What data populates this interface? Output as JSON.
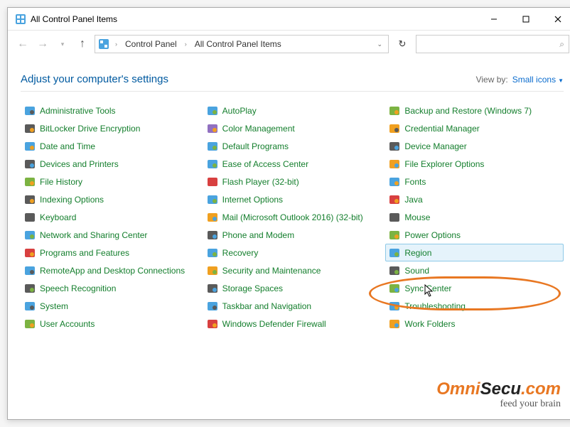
{
  "window": {
    "title": "All Control Panel Items"
  },
  "breadcrumb": {
    "root": "Control Panel",
    "leaf": "All Control Panel Items"
  },
  "search": {
    "placeholder": ""
  },
  "heading": "Adjust your computer's settings",
  "view": {
    "label": "View by:",
    "value": "Small icons"
  },
  "cols": [
    [
      "Administrative Tools",
      "BitLocker Drive Encryption",
      "Date and Time",
      "Devices and Printers",
      "File History",
      "Indexing Options",
      "Keyboard",
      "Network and Sharing Center",
      "Programs and Features",
      "RemoteApp and Desktop Connections",
      "Speech Recognition",
      "System",
      "User Accounts"
    ],
    [
      "AutoPlay",
      "Color Management",
      "Default Programs",
      "Ease of Access Center",
      "Flash Player (32-bit)",
      "Internet Options",
      "Mail (Microsoft Outlook 2016) (32-bit)",
      "Phone and Modem",
      "Recovery",
      "Security and Maintenance",
      "Storage Spaces",
      "Taskbar and Navigation",
      "Windows Defender Firewall"
    ],
    [
      "Backup and Restore (Windows 7)",
      "Credential Manager",
      "Device Manager",
      "File Explorer Options",
      "Fonts",
      "Java",
      "Mouse",
      "Power Options",
      "Region",
      "Sound",
      "Sync Center",
      "Troubleshooting",
      "Work Folders"
    ]
  ],
  "icons": {
    "c0": [
      "admin-tools",
      "bitlocker",
      "date-time",
      "devices-printers",
      "file-history",
      "indexing",
      "keyboard",
      "network-sharing",
      "programs-features",
      "remoteapp",
      "speech",
      "system",
      "user-accounts"
    ],
    "c1": [
      "autoplay",
      "color-mgmt",
      "default-programs",
      "ease-access",
      "flash",
      "internet",
      "mail",
      "phone-modem",
      "recovery",
      "security",
      "storage",
      "taskbar",
      "defender"
    ],
    "c2": [
      "backup",
      "credential",
      "device-mgr",
      "explorer-opts",
      "fonts",
      "java",
      "mouse",
      "power",
      "region",
      "sound",
      "sync",
      "troubleshoot",
      "work-folders"
    ]
  },
  "watermark": {
    "brand1": "Omni",
    "brand2": "Secu",
    "brand3": ".com",
    "tag": "feed your brain"
  },
  "highlight": {
    "col": 2,
    "row": 8
  }
}
